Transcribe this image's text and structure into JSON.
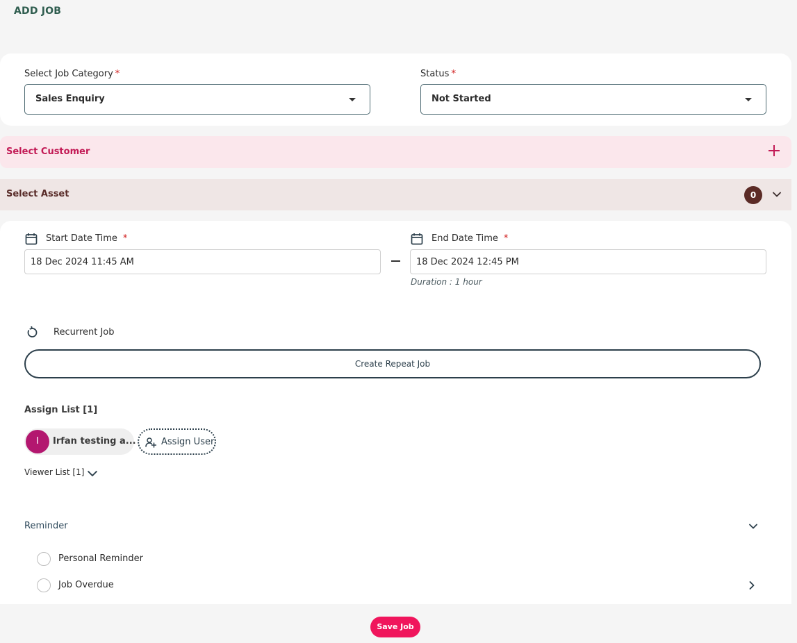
{
  "page": {
    "title": "ADD JOB"
  },
  "job_category": {
    "label": "Select Job Category",
    "required": "*",
    "value": "Sales Enquiry"
  },
  "status": {
    "label": "Status",
    "required": "*",
    "value": "Not Started"
  },
  "customer": {
    "label": "Select Customer"
  },
  "asset": {
    "label": "Select Asset",
    "count": "0"
  },
  "schedule": {
    "start_label": "Start Date Time",
    "start_value": "18 Dec 2024 11:45 AM",
    "end_label": "End Date Time",
    "end_value": "18 Dec 2024 12:45 PM",
    "required": "*",
    "duration": "Duration : 1 hour"
  },
  "recurrence": {
    "label": "Recurrent Job",
    "button": "Create Repeat Job"
  },
  "assign": {
    "title": "Assign List [1]",
    "users": [
      {
        "initial": "I",
        "name": "Irfan testing a..."
      }
    ],
    "assign_button": "Assign User"
  },
  "viewer": {
    "label": "Viewer List [1]"
  },
  "reminder": {
    "label": "Reminder",
    "options": [
      "Personal Reminder",
      "Job Overdue"
    ]
  },
  "actions": {
    "save": "Save Job"
  },
  "colors": {
    "accent": "#f0155c",
    "customer_bar": "#fbe7ec",
    "asset_bar": "#efe6e5",
    "avatar": "#b3176f"
  }
}
